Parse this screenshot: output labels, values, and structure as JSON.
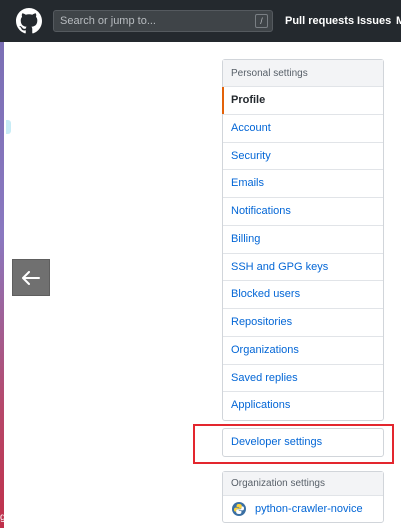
{
  "header": {
    "search_placeholder": "Search or jump to...",
    "search_shortcut": "/",
    "nav": [
      "Pull requests",
      "Issues",
      "M"
    ]
  },
  "left_edge": {
    "glyph": "g"
  },
  "personal_settings": {
    "heading": "Personal settings",
    "selected": "Profile",
    "items": [
      "Profile",
      "Account",
      "Security",
      "Emails",
      "Notifications",
      "Billing",
      "SSH and GPG keys",
      "Blocked users",
      "Repositories",
      "Organizations",
      "Saved replies",
      "Applications"
    ]
  },
  "developer_settings": {
    "label": "Developer settings"
  },
  "organization_settings": {
    "heading": "Organization settings",
    "items": [
      "python-crawler-novice"
    ]
  },
  "colors": {
    "header_bg": "#24292e",
    "link": "#0366d6",
    "selected_accent": "#e36209",
    "highlight_box": "#e3262e"
  }
}
